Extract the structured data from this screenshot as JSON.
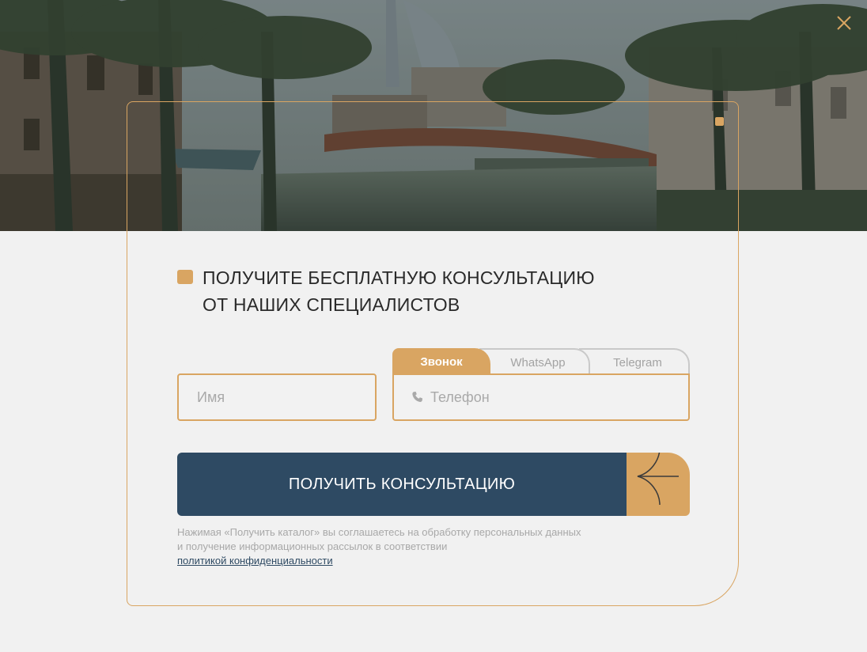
{
  "form": {
    "title_line1": "ПОЛУЧИТЕ БЕСПЛАТНУЮ КОНСУЛЬТАЦИЮ",
    "title_line2": "ОТ НАШИХ СПЕЦИАЛИСТОВ",
    "name_placeholder": "Имя",
    "phone_placeholder": "Телефон",
    "tabs": [
      {
        "label": "Звонок",
        "active": true
      },
      {
        "label": "WhatsApp",
        "active": false
      },
      {
        "label": "Telegram",
        "active": false
      }
    ],
    "submit_label": "ПОЛУЧИТЬ КОНСУЛЬТАЦИЮ",
    "consent_line1": "Нажимая «Получить каталог» вы соглашаетесь на обработку персональных данных",
    "consent_line2": "и получение информационных рассылок в соответствии",
    "consent_link": "политикой конфиденциальности"
  },
  "colors": {
    "accent": "#d9a562",
    "primary": "#2e4a63",
    "background": "#f1f1f1"
  },
  "icons": {
    "close": "close-icon",
    "phone": "phone-icon",
    "arrow": "arrow-left-icon"
  }
}
